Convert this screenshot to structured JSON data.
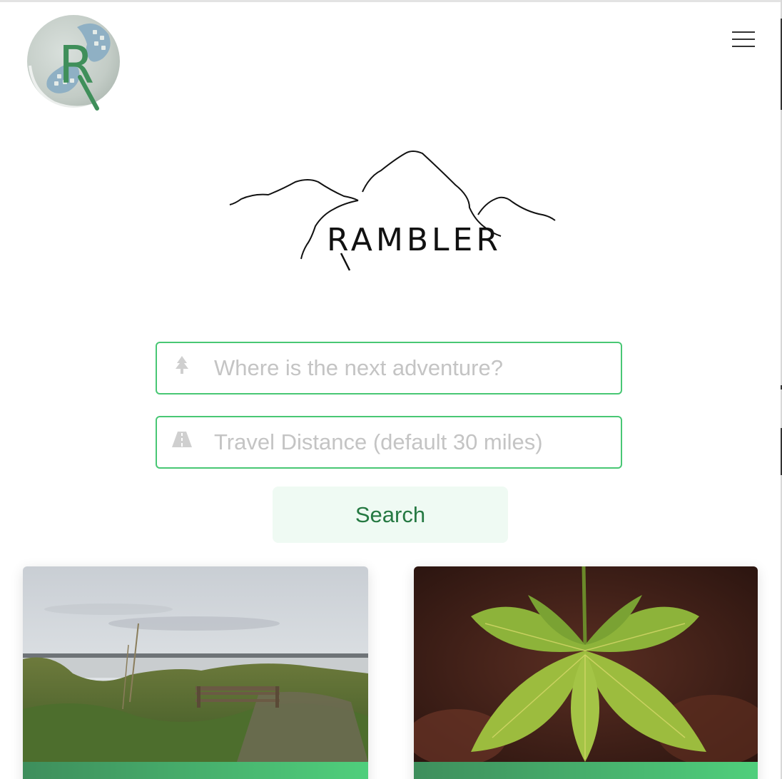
{
  "header": {
    "brand_badge_letter": "R",
    "menu_icon": "hamburger-menu-icon"
  },
  "hero": {
    "logo_text": "RAMBLER"
  },
  "search": {
    "destination": {
      "icon": "tree-icon",
      "placeholder": "Where is the next adventure?",
      "value": ""
    },
    "distance": {
      "icon": "road-icon",
      "placeholder": "Travel Distance (default 30 miles)",
      "value": ""
    },
    "button_label": "Search"
  },
  "cards": [
    {
      "image": "lakeside-bench-photo"
    },
    {
      "image": "green-leaf-photo"
    }
  ],
  "colors": {
    "accent_green": "#48c774",
    "button_bg": "#effaf3",
    "button_text": "#257942",
    "badge_letter": "#3f8f5a",
    "badge_boot": "#8fb0c4"
  }
}
